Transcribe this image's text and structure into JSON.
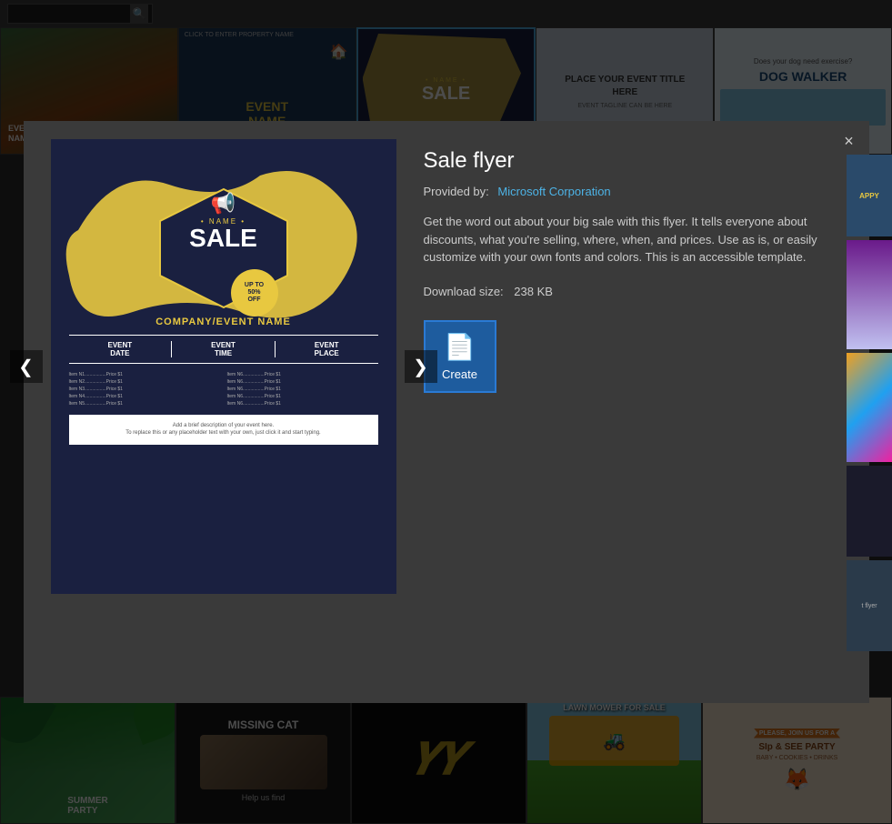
{
  "topBar": {
    "searchPlaceholder": ""
  },
  "topThumbnails": [
    {
      "id": "thumb-food",
      "label": "Food event template",
      "bgStyle": "food"
    },
    {
      "id": "thumb-house",
      "label": "House event template",
      "text": "EVENT\nNAME\nHERE",
      "subtext": "CLICK TO ENTER PROPERTY NAME"
    },
    {
      "id": "thumb-sale",
      "label": "Sale flyer template active",
      "text": "• NAME •\nSALE"
    },
    {
      "id": "thumb-event-title",
      "label": "Event title template",
      "text": "PLACE YOUR EVENT TITLE\nHERE",
      "subtext": "EVENT TAGLINE CAN BE HERE"
    },
    {
      "id": "thumb-dog-walker",
      "label": "Dog walker flyer",
      "text": "Does your dog need exercise?\nDOG WALKER"
    }
  ],
  "modal": {
    "closeLabel": "×",
    "title": "Sale flyer",
    "providerLabel": "Provided by:",
    "providerName": "Microsoft Corporation",
    "description": "Get the word out about your big sale with this flyer. It tells everyone about discounts, what you're selling, where, when, and prices. Use as is, or easily customize with your own fonts and colors. This is an accessible template.",
    "downloadLabel": "Download size:",
    "downloadSize": "238 KB",
    "createLabel": "Create",
    "flyer": {
      "nameText": "• NAME •",
      "saleText": "SALE",
      "discountLine1": "UP TO",
      "discountLine2": "50%",
      "discountLine3": "OFF",
      "companyName": "COMPANY/EVENT NAME",
      "eventDate": "EVENT\nDATE",
      "eventTime": "EVENT\nTIME",
      "eventPlace": "EVENT\nPLACE",
      "items1": [
        "Item N1...............Price $1",
        "Item N2...............Price $1",
        "Item N3...............Price $1",
        "Item N4...............Price $1",
        "Item N5...............Price $1"
      ],
      "items2": [
        "Item N6...............Price $1",
        "Item N6...............Price $1",
        "Item N6...............Price $1",
        "Item N6...............Price $1",
        "Item N6...............Price $1"
      ],
      "descriptionText": "Add a brief description of your event here.\nTo replace this or any placeholder text with your own, just click it and start typing."
    }
  },
  "navArrows": {
    "leftLabel": "❮",
    "rightLabel": "❯"
  },
  "bottomThumbnails": [
    {
      "id": "bthumb-summer",
      "label": "Summer party template",
      "type": "summer"
    },
    {
      "id": "bthumb-missing-cat",
      "label": "Missing cat flyer",
      "title": "MISSING CAT",
      "subtext": "Help us find",
      "type": "missing-cat"
    },
    {
      "id": "bthumb-gold-logo",
      "label": "Gold logo template",
      "type": "gold-logo"
    },
    {
      "id": "bthumb-lawn-mower",
      "label": "Lawn mower for sale",
      "title": "LAWN MOWER FOR SALE",
      "type": "lawn-mower"
    },
    {
      "id": "bthumb-sip-see",
      "label": "Sip and see party",
      "line1": "PLEASE, JOIN US FOR A",
      "line2": "SIp & SEE PARTY",
      "line3": "BABY • COOKIES • DRINKS",
      "type": "sip-see"
    }
  ],
  "rightSidePanels": [
    {
      "id": "rsp-happy",
      "text": "APPY",
      "type": "dark-blue"
    },
    {
      "id": "rsp-purple",
      "type": "purple"
    },
    {
      "id": "rsp-colorful",
      "type": "colorful"
    },
    {
      "id": "rsp-dark",
      "type": "dark"
    },
    {
      "id": "rsp-last",
      "text": "t flyer",
      "type": "last"
    }
  ],
  "colors": {
    "accent": "#4db3e6",
    "modalBg": "#3a3a3a",
    "flyerBg": "#1a2040",
    "flyerYellow": "#e8c840",
    "createBtnBg": "#1e5c9e"
  }
}
